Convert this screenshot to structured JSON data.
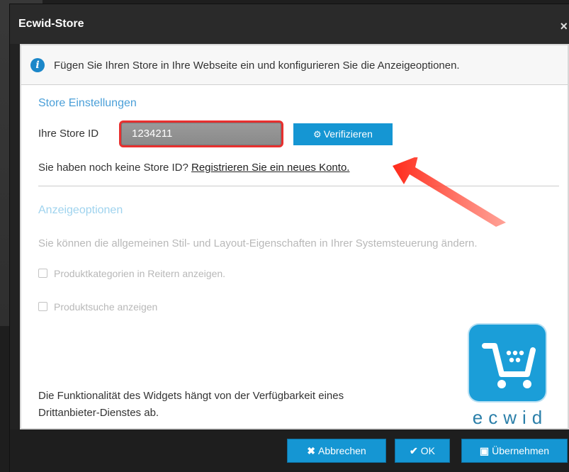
{
  "dialog": {
    "title": "Ecwid-Store",
    "close_glyph": "×",
    "info_text": "Fügen Sie Ihren Store in Ihre Webseite ein und konfigurieren Sie die Anzeigeoptionen.",
    "info_icon_glyph": "i"
  },
  "store_settings": {
    "heading": "Store Einstellungen",
    "store_id_label": "Ihre Store ID",
    "store_id_value": "1234211",
    "verify_label": "Verifizieren",
    "verify_icon_glyph": "⚙",
    "no_id_text": "Sie haben noch keine Store ID? ",
    "register_link": "Registrieren Sie ein neues Konto."
  },
  "display_options": {
    "heading": "Anzeigeoptionen",
    "description": "Sie können die allgemeinen Stil- und Layout-Eigenschaften in Ihrer Systemsteuerung ändern.",
    "option_categories": "Produktkategorien in Reitern anzeigen.",
    "option_search": "Produktsuche anzeigen"
  },
  "footnote": {
    "line1": "Die Funktionalität des Widgets hängt von der Verfügbarkeit eines",
    "line2": "Drittanbieter-Dienstes ab."
  },
  "logo": {
    "word": "ecwid",
    "icon": "shopping-cart-icon"
  },
  "footer": {
    "cancel_label": "Abbrechen",
    "cancel_glyph": "✖",
    "ok_label": "OK",
    "ok_glyph": "✔",
    "apply_label": "Übernehmen",
    "apply_glyph": "💾"
  },
  "colors": {
    "accent": "#1596d3",
    "highlight_border": "#e8302f",
    "arrow": "#e8302f"
  }
}
